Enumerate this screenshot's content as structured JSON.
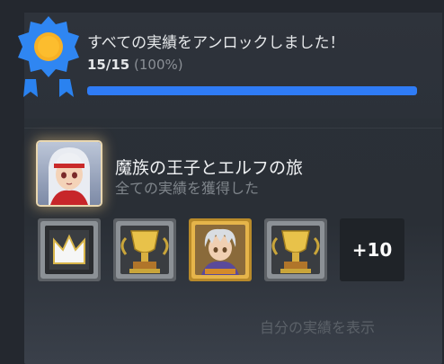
{
  "unlock": {
    "title": "すべての実績をアンロックしました！",
    "count": "15/15",
    "percent": "(100%)",
    "progress_fraction": 1.0,
    "bar_color": "#2f7cf6",
    "badge_icon": "ribbon-medal-icon"
  },
  "game": {
    "title": "魔族の王子とエルフの旅",
    "subtitle": "全ての実績を獲得した",
    "icon": "game-portrait-icon"
  },
  "achievements": {
    "icons": [
      "crown-achievement-icon",
      "trophy-achievement-icon",
      "character-achievement-icon",
      "trophy-achievement-icon"
    ],
    "more_label": "+10"
  },
  "footer": {
    "show_label": "自分の実績を表示"
  }
}
